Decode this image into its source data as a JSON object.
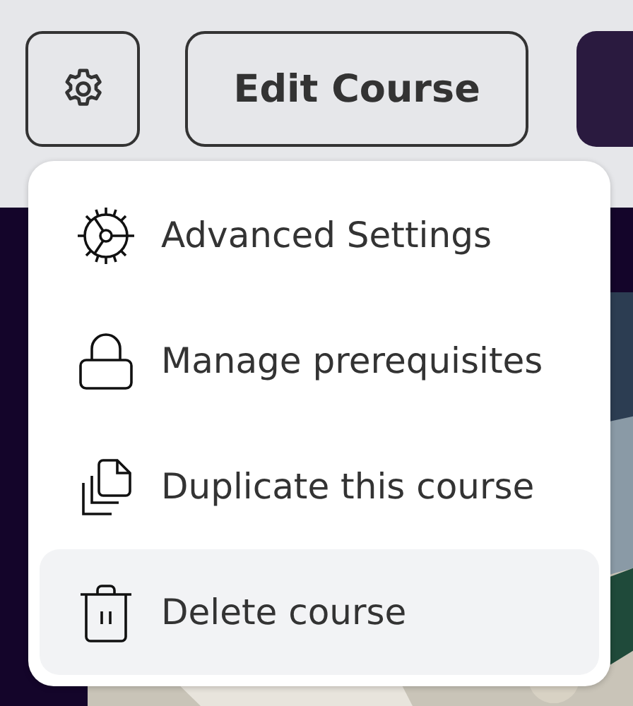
{
  "toolbar": {
    "edit_button": "Edit Course"
  },
  "menu": {
    "items": [
      {
        "label": "Advanced Settings",
        "kind": "settings",
        "selected": false
      },
      {
        "label": "Manage prerequisites",
        "kind": "lock",
        "selected": false
      },
      {
        "label": "Duplicate this course",
        "kind": "duplicate",
        "selected": false
      },
      {
        "label": "Delete course",
        "kind": "delete",
        "selected": true
      }
    ]
  }
}
